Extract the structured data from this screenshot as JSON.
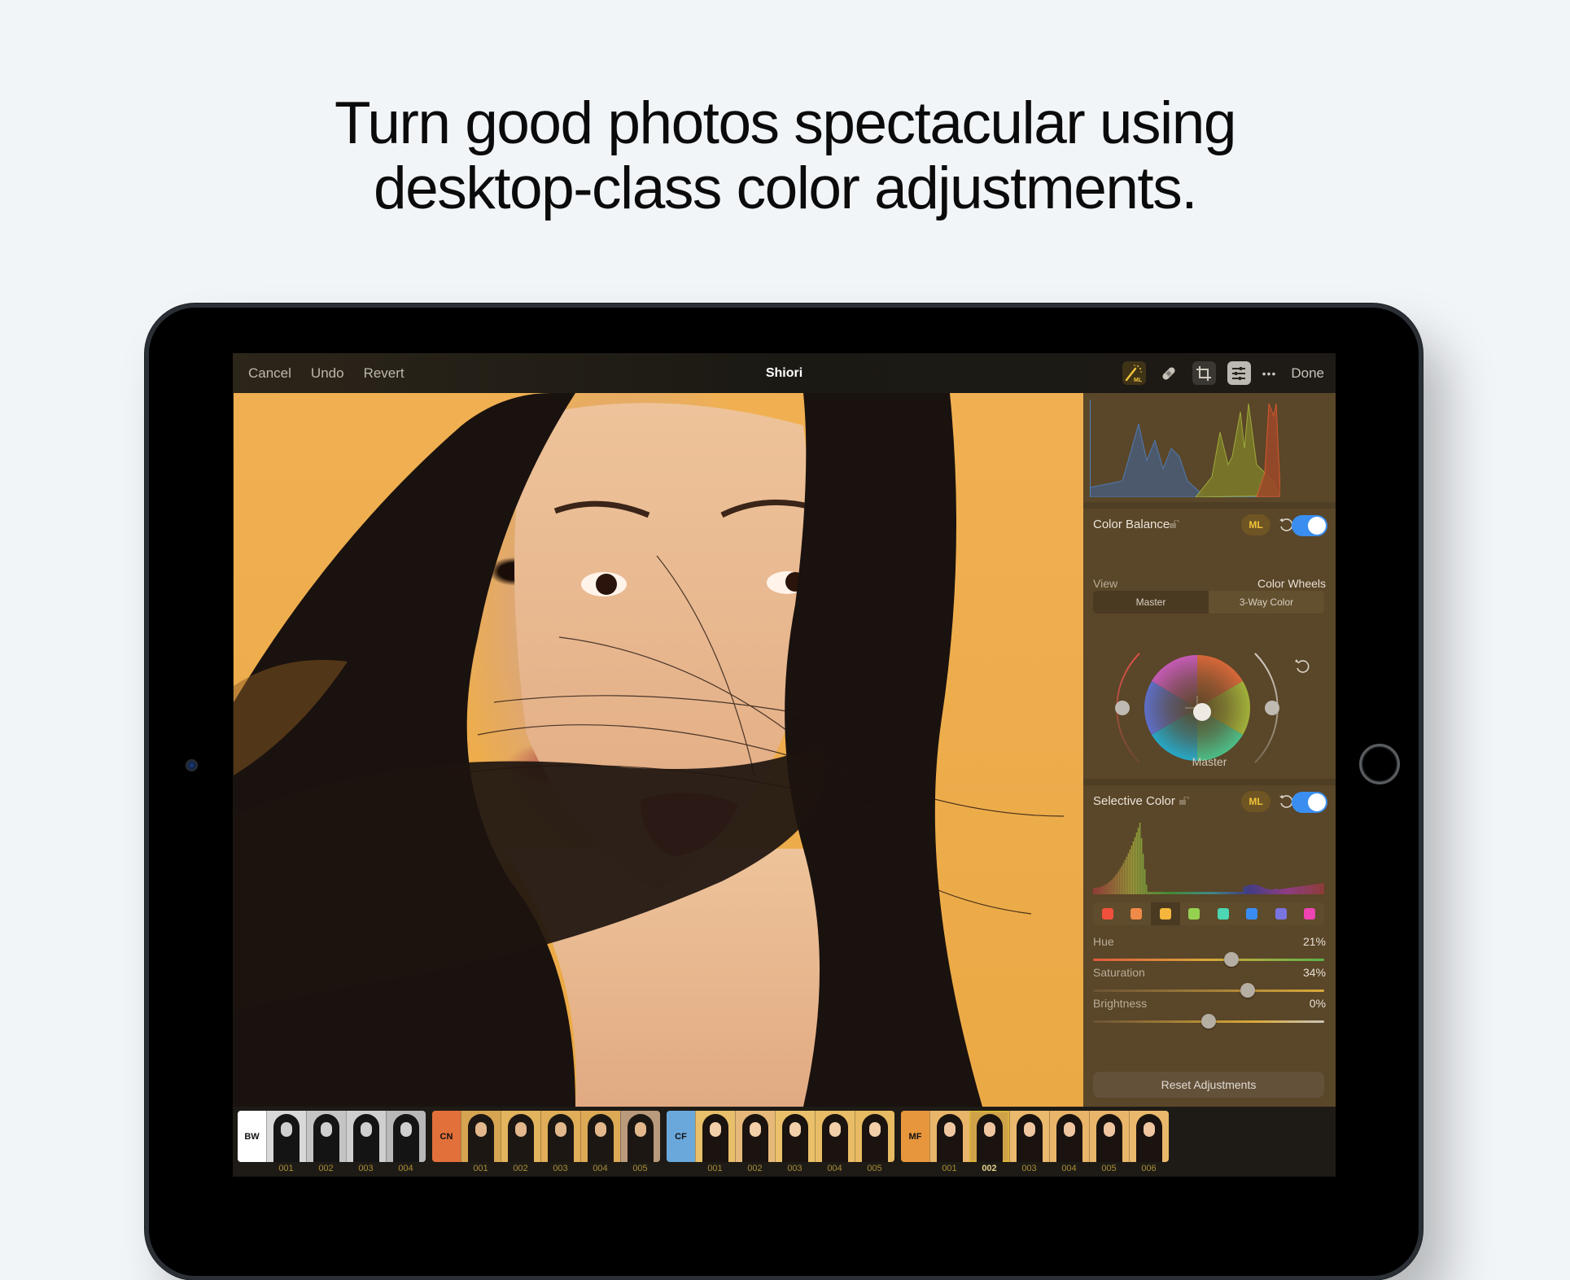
{
  "headline": {
    "line1": "Turn good photos spectacular using",
    "line2": "desktop-class color adjustments."
  },
  "toolbar": {
    "cancel_label": "Cancel",
    "undo_label": "Undo",
    "revert_label": "Revert",
    "title": "Shiori",
    "done_label": "Done",
    "icons": [
      "ml-magic-wand-icon",
      "bandage-repair-icon",
      "crop-icon",
      "adjustments-sliders-icon",
      "more-ellipsis-icon"
    ],
    "more_label": "•••",
    "ml_icon_text": "ML"
  },
  "sidebar": {
    "color_balance": {
      "title": "Color Balance",
      "ml_label": "ML",
      "enabled": true,
      "view_label": "View",
      "view_value": "Color Wheels",
      "segments": [
        "Master",
        "3-Way Color"
      ],
      "active_segment": "Master",
      "wheel_label": "Master"
    },
    "selective_color": {
      "title": "Selective Color",
      "ml_label": "ML",
      "enabled": true,
      "swatches": [
        {
          "name": "red",
          "color": "#f0503c"
        },
        {
          "name": "orange",
          "color": "#f08a48"
        },
        {
          "name": "yellow",
          "color": "#f4b63c"
        },
        {
          "name": "green",
          "color": "#96d250"
        },
        {
          "name": "aqua",
          "color": "#4cd6b4"
        },
        {
          "name": "blue",
          "color": "#3a8cf4"
        },
        {
          "name": "purple",
          "color": "#7a74e0"
        },
        {
          "name": "magenta",
          "color": "#ee44b4"
        }
      ],
      "selected_swatch": "yellow",
      "sliders": [
        {
          "label": "Hue",
          "value": "21%",
          "position": 0.6
        },
        {
          "label": "Saturation",
          "value": "34%",
          "position": 0.67
        },
        {
          "label": "Brightness",
          "value": "0%",
          "position": 0.5
        }
      ]
    },
    "reset_label": "Reset Adjustments"
  },
  "filmstrip": {
    "groups": [
      {
        "tag": "BW",
        "tag_color": "#ffffff",
        "thumbs": [
          "001",
          "002",
          "003",
          "004"
        ],
        "tone": "bw"
      },
      {
        "tag": "CN",
        "tag_color": "#e2703a",
        "thumbs": [
          "001",
          "002",
          "003",
          "004",
          "005"
        ],
        "tone": "cn"
      },
      {
        "tag": "CF",
        "tag_color": "#6aa8dc",
        "thumbs": [
          "001",
          "002",
          "003",
          "004",
          "005"
        ],
        "tone": "cf"
      },
      {
        "tag": "MF",
        "tag_color": "#e8963c",
        "thumbs": [
          "001",
          "002",
          "003",
          "004",
          "005",
          "006"
        ],
        "tone": "mf"
      }
    ],
    "selected": {
      "group": "MF",
      "thumb": "002"
    }
  },
  "colors": {
    "accent_toggle": "#3a8ef0",
    "ml_badge_text": "#f1c43a",
    "panel_bg": "#5a4628",
    "photo_bg": "#eba945"
  }
}
